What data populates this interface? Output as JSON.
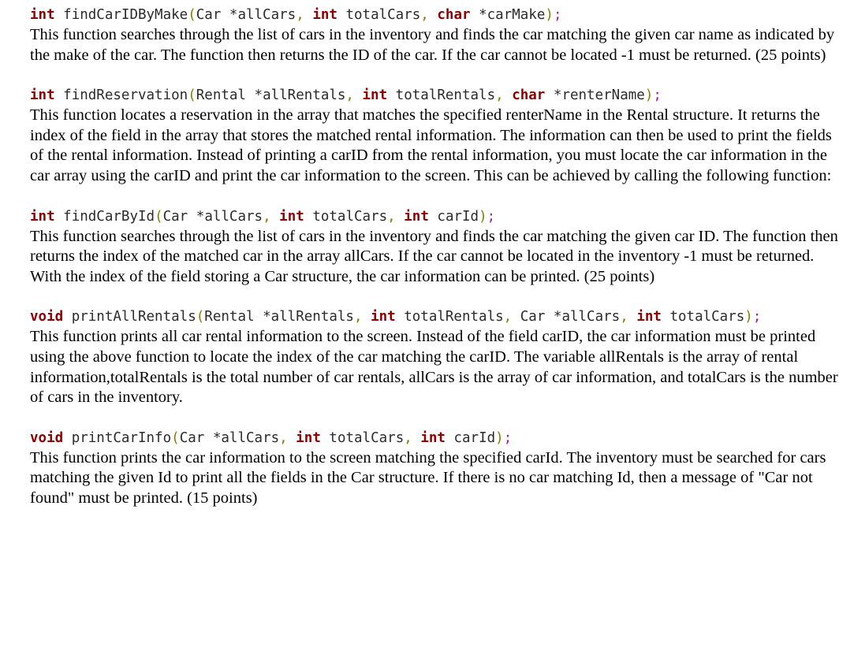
{
  "document": {
    "type": "assignment-specification",
    "colors": {
      "keyword": "#8f0000",
      "identifier": "#2b2b2b",
      "punctuation": "#7f7f00",
      "semicolon": "#a020a0",
      "text": "#000000",
      "background": "#ffffff"
    }
  },
  "sections": [
    {
      "id": "find-car-id-by-make",
      "signature": {
        "tokens": [
          {
            "t": "int",
            "c": "kw"
          },
          {
            "t": " ",
            "c": "sp"
          },
          {
            "t": "findCarIDByMake",
            "c": "id"
          },
          {
            "t": "(",
            "c": "punc"
          },
          {
            "t": "Car",
            "c": "type"
          },
          {
            "t": " ",
            "c": "sp"
          },
          {
            "t": "*",
            "c": "star"
          },
          {
            "t": "allCars",
            "c": "id"
          },
          {
            "t": ",",
            "c": "punc"
          },
          {
            "t": " ",
            "c": "sp"
          },
          {
            "t": "int",
            "c": "kw"
          },
          {
            "t": " ",
            "c": "sp"
          },
          {
            "t": "totalCars",
            "c": "id"
          },
          {
            "t": ",",
            "c": "punc"
          },
          {
            "t": " ",
            "c": "sp"
          },
          {
            "t": "char",
            "c": "kw"
          },
          {
            "t": " ",
            "c": "sp"
          },
          {
            "t": "*",
            "c": "star"
          },
          {
            "t": "carMake",
            "c": "id"
          },
          {
            "t": ")",
            "c": "punc"
          },
          {
            "t": ";",
            "c": "semi"
          }
        ]
      },
      "description": "This function searches through the list of cars in the inventory and finds the car matching the given car name as indicated by the make of the car. The function then returns the ID of the car. If the car cannot be located -1 must be returned. (25 points)",
      "points": "25 points"
    },
    {
      "id": "find-reservation",
      "signature": {
        "tokens": [
          {
            "t": "int",
            "c": "kw"
          },
          {
            "t": " ",
            "c": "sp"
          },
          {
            "t": "findReservation",
            "c": "id"
          },
          {
            "t": "(",
            "c": "punc"
          },
          {
            "t": "Rental",
            "c": "type"
          },
          {
            "t": " ",
            "c": "sp"
          },
          {
            "t": "*",
            "c": "star"
          },
          {
            "t": "allRentals",
            "c": "id"
          },
          {
            "t": ",",
            "c": "punc"
          },
          {
            "t": " ",
            "c": "sp"
          },
          {
            "t": "int",
            "c": "kw"
          },
          {
            "t": " ",
            "c": "sp"
          },
          {
            "t": "totalRentals",
            "c": "id"
          },
          {
            "t": ",",
            "c": "punc"
          },
          {
            "t": " ",
            "c": "sp"
          },
          {
            "t": "char",
            "c": "kw"
          },
          {
            "t": " ",
            "c": "sp"
          },
          {
            "t": "*",
            "c": "star"
          },
          {
            "t": "renterName",
            "c": "id"
          },
          {
            "t": ")",
            "c": "punc"
          },
          {
            "t": ";",
            "c": "semi"
          }
        ]
      },
      "description": "This function locates a reservation in the array that matches the specified renterName in the Rental structure. It returns the index of the field in the array that stores the matched rental information. The information can then be used to print the fields of the rental information. Instead of printing a carID from the rental information, you must locate the car information in the car array using the carID and print the car information to the screen. This can be achieved by calling the following function:",
      "points": ""
    },
    {
      "id": "find-car-by-id",
      "signature": {
        "tokens": [
          {
            "t": "int",
            "c": "kw"
          },
          {
            "t": " ",
            "c": "sp"
          },
          {
            "t": "findCarById",
            "c": "id"
          },
          {
            "t": "(",
            "c": "punc"
          },
          {
            "t": "Car",
            "c": "type"
          },
          {
            "t": " ",
            "c": "sp"
          },
          {
            "t": "*",
            "c": "star"
          },
          {
            "t": "allCars",
            "c": "id"
          },
          {
            "t": ",",
            "c": "punc"
          },
          {
            "t": " ",
            "c": "sp"
          },
          {
            "t": "int",
            "c": "kw"
          },
          {
            "t": " ",
            "c": "sp"
          },
          {
            "t": "totalCars",
            "c": "id"
          },
          {
            "t": ",",
            "c": "punc"
          },
          {
            "t": " ",
            "c": "sp"
          },
          {
            "t": "int",
            "c": "kw"
          },
          {
            "t": " ",
            "c": "sp"
          },
          {
            "t": "carId",
            "c": "id"
          },
          {
            "t": ")",
            "c": "punc"
          },
          {
            "t": ";",
            "c": "semi"
          }
        ]
      },
      "description": "This function searches through the list of cars in the inventory and finds the car matching the given car ID. The function then returns the index of the matched car in the array allCars. If the car cannot be located in the inventory -1 must be returned. With the index of the field storing a Car structure, the car information can be printed. (25 points)",
      "points": "25 points"
    },
    {
      "id": "print-all-rentals",
      "signature": {
        "tokens": [
          {
            "t": "void",
            "c": "kw"
          },
          {
            "t": " ",
            "c": "sp"
          },
          {
            "t": "printAllRentals",
            "c": "id"
          },
          {
            "t": "(",
            "c": "punc"
          },
          {
            "t": "Rental",
            "c": "type"
          },
          {
            "t": " ",
            "c": "sp"
          },
          {
            "t": "*",
            "c": "star"
          },
          {
            "t": "allRentals",
            "c": "id"
          },
          {
            "t": ",",
            "c": "punc"
          },
          {
            "t": " ",
            "c": "sp"
          },
          {
            "t": "int",
            "c": "kw"
          },
          {
            "t": " ",
            "c": "sp"
          },
          {
            "t": "totalRentals",
            "c": "id"
          },
          {
            "t": ",",
            "c": "punc"
          },
          {
            "t": " ",
            "c": "sp"
          },
          {
            "t": "Car",
            "c": "type"
          },
          {
            "t": " ",
            "c": "sp"
          },
          {
            "t": "*",
            "c": "star"
          },
          {
            "t": "allCars",
            "c": "id"
          },
          {
            "t": ",",
            "c": "punc"
          },
          {
            "t": " ",
            "c": "sp"
          },
          {
            "t": "int",
            "c": "kw"
          },
          {
            "t": " ",
            "c": "sp"
          },
          {
            "t": "totalCars",
            "c": "id"
          },
          {
            "t": ")",
            "c": "punc"
          },
          {
            "t": ";",
            "c": "semi"
          }
        ]
      },
      "description": "This function prints all car rental information to the screen. Instead of the field carID, the car information must be printed using the above function to locate the index of the car matching the carID. The variable allRentals is the array of rental information,totalRentals is the total number of car rentals, allCars is the array of car information, and totalCars is the number of cars in the inventory.",
      "points": ""
    },
    {
      "id": "print-car-info",
      "signature": {
        "tokens": [
          {
            "t": "void",
            "c": "kw"
          },
          {
            "t": " ",
            "c": "sp"
          },
          {
            "t": "printCarInfo",
            "c": "id"
          },
          {
            "t": "(",
            "c": "punc"
          },
          {
            "t": "Car",
            "c": "type"
          },
          {
            "t": " ",
            "c": "sp"
          },
          {
            "t": "*",
            "c": "star"
          },
          {
            "t": "allCars",
            "c": "id"
          },
          {
            "t": ",",
            "c": "punc"
          },
          {
            "t": " ",
            "c": "sp"
          },
          {
            "t": "int",
            "c": "kw"
          },
          {
            "t": " ",
            "c": "sp"
          },
          {
            "t": "totalCars",
            "c": "id"
          },
          {
            "t": ",",
            "c": "punc"
          },
          {
            "t": " ",
            "c": "sp"
          },
          {
            "t": "int",
            "c": "kw"
          },
          {
            "t": " ",
            "c": "sp"
          },
          {
            "t": "carId",
            "c": "id"
          },
          {
            "t": ")",
            "c": "punc"
          },
          {
            "t": ";",
            "c": "semi"
          }
        ]
      },
      "description": "This function prints the car information to the screen matching the specified carId. The inventory must be searched for cars matching the given Id to print all the fields in the Car structure. If there is no car matching Id, then a message of \"Car not found\" must be printed. (15 points)",
      "points": "15 points"
    }
  ]
}
